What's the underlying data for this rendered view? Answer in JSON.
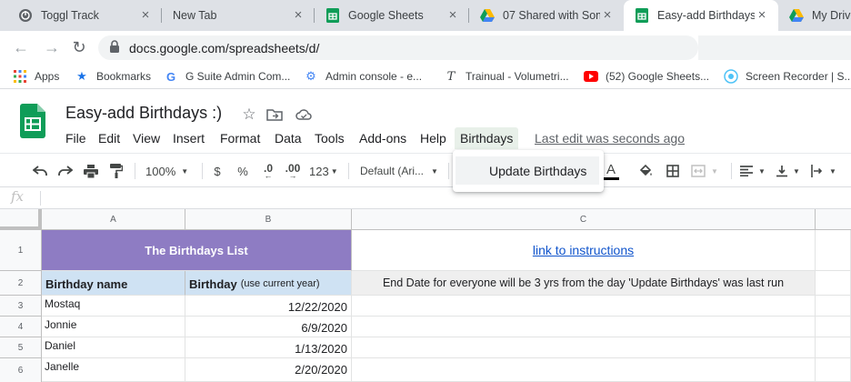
{
  "browser": {
    "tabs": [
      {
        "title": "Toggl Track",
        "icon": "toggl-icon",
        "active": false
      },
      {
        "title": "New Tab",
        "icon": "",
        "active": false
      },
      {
        "title": "Google Sheets",
        "icon": "sheets-icon",
        "active": false
      },
      {
        "title": "07 Shared with Som",
        "icon": "drive-icon",
        "active": false
      },
      {
        "title": "Easy-add Birthdays",
        "icon": "sheets-icon",
        "active": true
      },
      {
        "title": "My Drive",
        "icon": "drive-icon",
        "active": false
      }
    ],
    "tab_close_glyph": "×",
    "url": "docs.google.com/spreadsheets/d/",
    "bookmarks": [
      {
        "label": "Apps",
        "icon": "apps-grid-icon"
      },
      {
        "label": "Bookmarks",
        "icon": "star-icon"
      },
      {
        "label": "G Suite Admin Com...",
        "icon": "google-g-icon"
      },
      {
        "label": "Admin console - e...",
        "icon": "admin-gear-icon"
      },
      {
        "label": "Trainual - Volumetri...",
        "icon": "trainual-icon"
      },
      {
        "label": "(52) Google Sheets...",
        "icon": "youtube-icon"
      },
      {
        "label": "Screen Recorder | S...",
        "icon": "recorder-icon"
      }
    ]
  },
  "sheet": {
    "title": "Easy-add Birthdays :)",
    "menus": [
      "File",
      "Edit",
      "View",
      "Insert",
      "Format",
      "Data",
      "Tools",
      "Add-ons",
      "Help",
      "Birthdays"
    ],
    "last_edit": "Last edit was seconds ago",
    "toolbar": {
      "zoom": "100%",
      "currency": "$",
      "percent": "%",
      "decrease_decimal": ".0",
      "increase_decimal": ".00",
      "more_formats": "123",
      "font": "Default (Ari...",
      "text_color_letter": "A"
    },
    "birthdays_menu": {
      "items": [
        "Update Birthdays"
      ]
    },
    "formula_bar": {
      "fx": "fx",
      "value": ""
    },
    "columns": [
      "A",
      "B",
      "C"
    ],
    "rows": [
      "1",
      "2",
      "3",
      "4",
      "5",
      "6"
    ],
    "cells": {
      "title": "The Birthdays List",
      "link": "link to instructions",
      "header_name": "Birthday name",
      "header_birthday": "Birthday",
      "header_birthday_note": "(use current year)",
      "note": "End Date for everyone will be 3 yrs from the day 'Update Birthdays' was last run",
      "entries": [
        {
          "name": "Mostaq",
          "date": "12/22/2020"
        },
        {
          "name": "Jonnie",
          "date": "6/9/2020"
        },
        {
          "name": "Daniel",
          "date": "1/13/2020"
        },
        {
          "name": "Janelle",
          "date": "2/20/2020"
        }
      ]
    },
    "colors": {
      "title_fill": "#8e7cc3",
      "header_fill": "#cfe2f3",
      "note_fill": "#efefef",
      "link": "#1155cc",
      "sheets_green": "#0f9d58"
    }
  }
}
